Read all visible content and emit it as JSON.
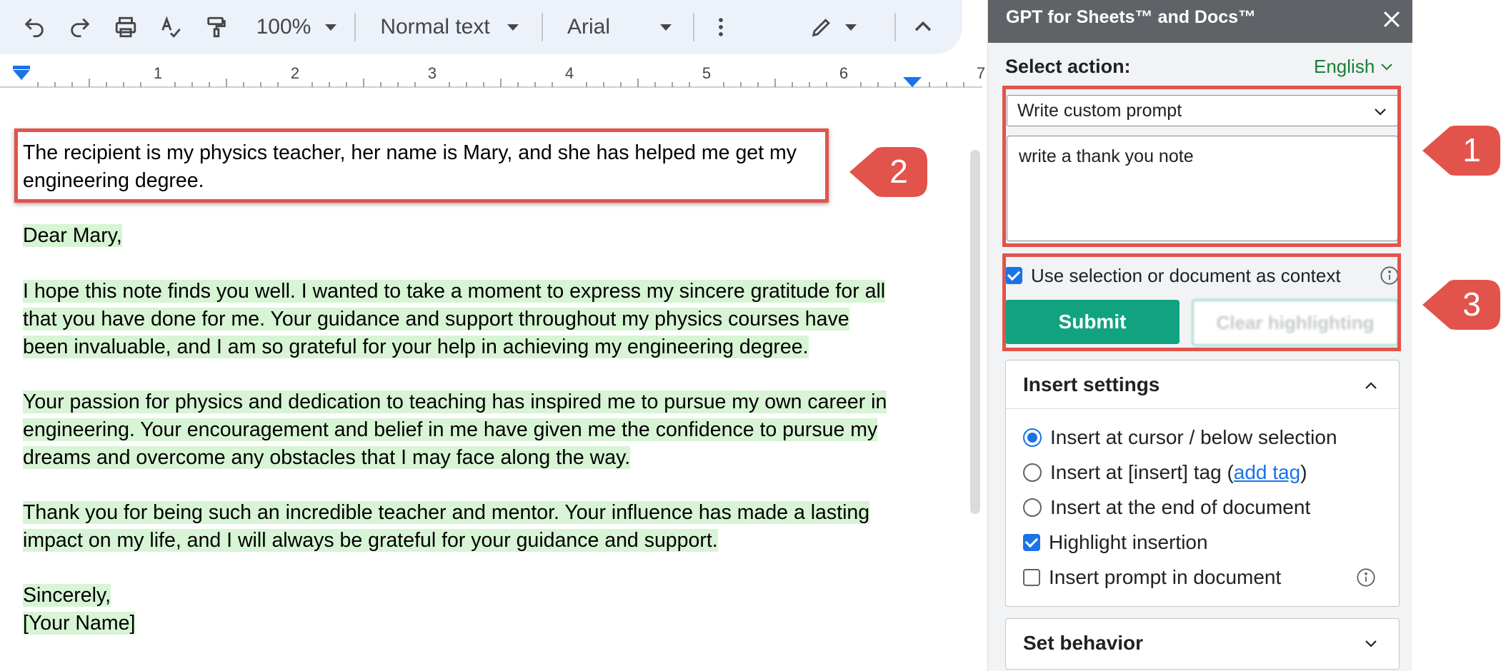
{
  "toolbar": {
    "zoom": "100%",
    "style": "Normal text",
    "font": "Arial"
  },
  "ruler": {
    "numbers": [
      "1",
      "2",
      "3",
      "4",
      "5",
      "6",
      "7"
    ]
  },
  "document": {
    "prompt_line_1": "The recipient is my physics teacher, her name is Mary, and she has helped me get my",
    "prompt_line_2": "engineering degree.",
    "greeting": "Dear Mary,",
    "p1": [
      "I hope this note finds you well. I wanted to take a moment to express my sincere gratitude for all",
      "that you have done for me. Your guidance and support throughout my physics courses have",
      "been invaluable, and I am so grateful for your help in achieving my engineering degree."
    ],
    "p2": [
      "Your passion for physics and dedication to teaching has inspired me to pursue my own career in",
      "engineering. Your encouragement and belief in me have given me the confidence to pursue my",
      "dreams and overcome any obstacles that I may face along the way."
    ],
    "p3": [
      "Thank you for being such an incredible teacher and mentor. Your influence has made a lasting",
      "impact on my life, and I will always be grateful for your guidance and support."
    ],
    "closing": "Sincerely,",
    "signature": "[Your Name]"
  },
  "callouts": {
    "one": "1",
    "two": "2",
    "three": "3",
    "color": "#e2534b"
  },
  "panel": {
    "title": "GPT for Sheets™ and Docs™",
    "select_action_label": "Select action:",
    "language": "English",
    "action_value": "Write custom prompt",
    "prompt_value": "write a thank you note",
    "context_label": "Use selection or document as context",
    "submit_label": "Submit",
    "clear_label": "Clear highlighting",
    "insert_settings": {
      "heading": "Insert settings",
      "opt_cursor": "Insert at cursor / below selection",
      "opt_tag_prefix": "Insert at [insert] tag (",
      "opt_tag_link": "add tag",
      "opt_tag_suffix": ")",
      "opt_end": "Insert at the end of document",
      "opt_highlight": "Highlight insertion",
      "opt_prompt": "Insert prompt in document"
    },
    "set_behavior": {
      "heading": "Set behavior"
    },
    "accent_color": "#11a37f",
    "link_color": "#188038"
  }
}
